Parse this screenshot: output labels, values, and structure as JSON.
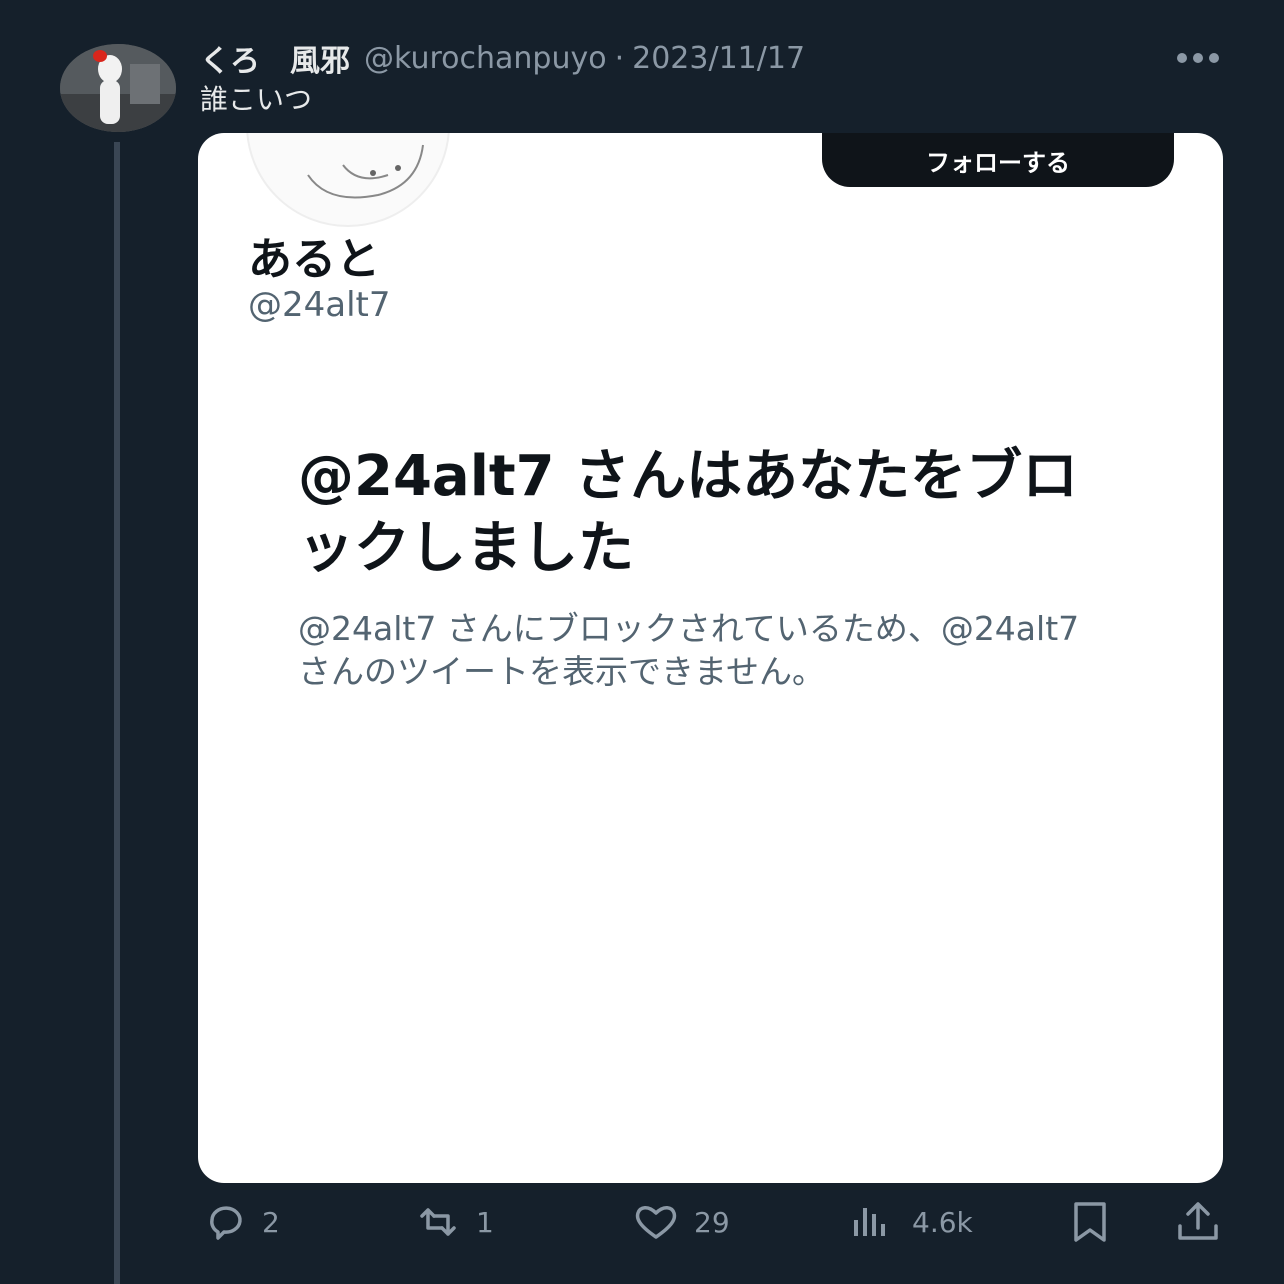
{
  "tweet": {
    "author_name": "くろ　風邪",
    "author_handle": "@kurochanpuyo",
    "separator": "·",
    "date": "2023/11/17",
    "text": "誰こいつ",
    "more_icon": "more-dots-icon"
  },
  "embedded_card": {
    "follow_label": "フォローする",
    "profile_name": "あると",
    "profile_handle": "@24alt7",
    "blocked_title": "@24alt7 さんはあなたをブロックしました",
    "blocked_description": "@24alt7 さんにブロックされているため、@24alt7 さんのツイートを表示できません。"
  },
  "actions": {
    "reply": {
      "icon": "reply-icon",
      "count": "2"
    },
    "repost": {
      "icon": "repost-icon",
      "count": "1"
    },
    "like": {
      "icon": "heart-icon",
      "count": "29"
    },
    "views": {
      "icon": "analytics-icon",
      "count": "4.6k"
    },
    "bookmark": {
      "icon": "bookmark-icon"
    },
    "share": {
      "icon": "share-icon"
    }
  },
  "colors": {
    "background": "#15202b",
    "text_primary": "#e7e9ea",
    "text_secondary": "#8b98a5",
    "card_background": "#ffffff",
    "follow_button": "#0f1419"
  }
}
